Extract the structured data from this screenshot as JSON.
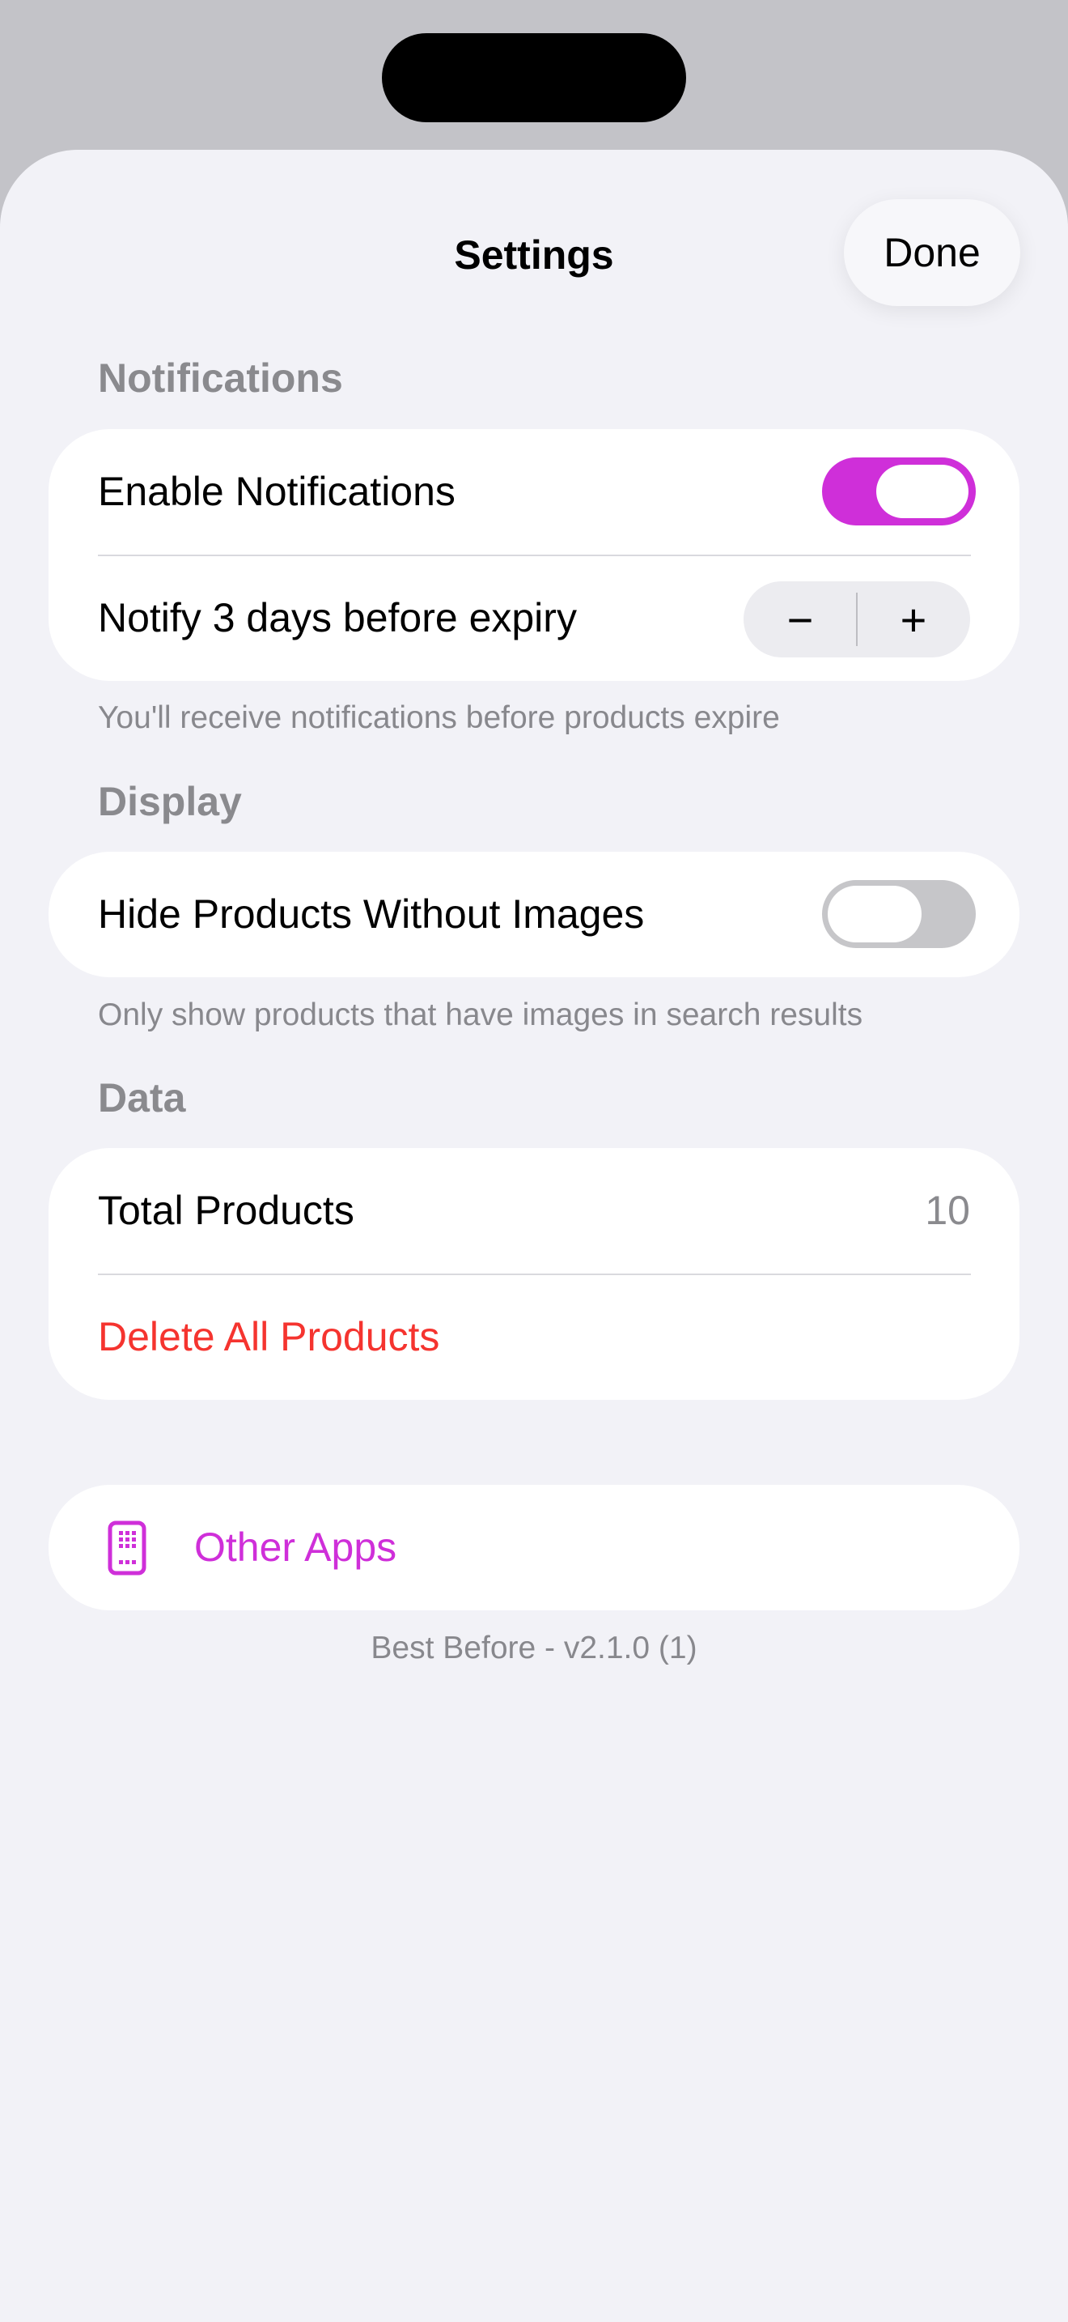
{
  "header": {
    "title": "Settings",
    "done_label": "Done"
  },
  "notifications": {
    "section_title": "Notifications",
    "enable_label": "Enable Notifications",
    "enable_on": true,
    "notify_label": "Notify 3 days before expiry",
    "days_before": 3,
    "decrement_symbol": "−",
    "increment_symbol": "+",
    "footer": "You'll receive notifications before products expire"
  },
  "display": {
    "section_title": "Display",
    "hide_label": "Hide Products Without Images",
    "hide_on": false,
    "footer": "Only show products that have images in search results"
  },
  "data": {
    "section_title": "Data",
    "total_label": "Total Products",
    "total_value": "10",
    "delete_label": "Delete All Products"
  },
  "other": {
    "label": "Other Apps",
    "icon": "app-grid-phone-icon"
  },
  "version": "Best Before - v2.1.0 (1)",
  "colors": {
    "accent": "#cf2fd9",
    "danger": "#f5342f",
    "background": "#f2f2f7",
    "toggle_off": "#c6c6c9"
  }
}
